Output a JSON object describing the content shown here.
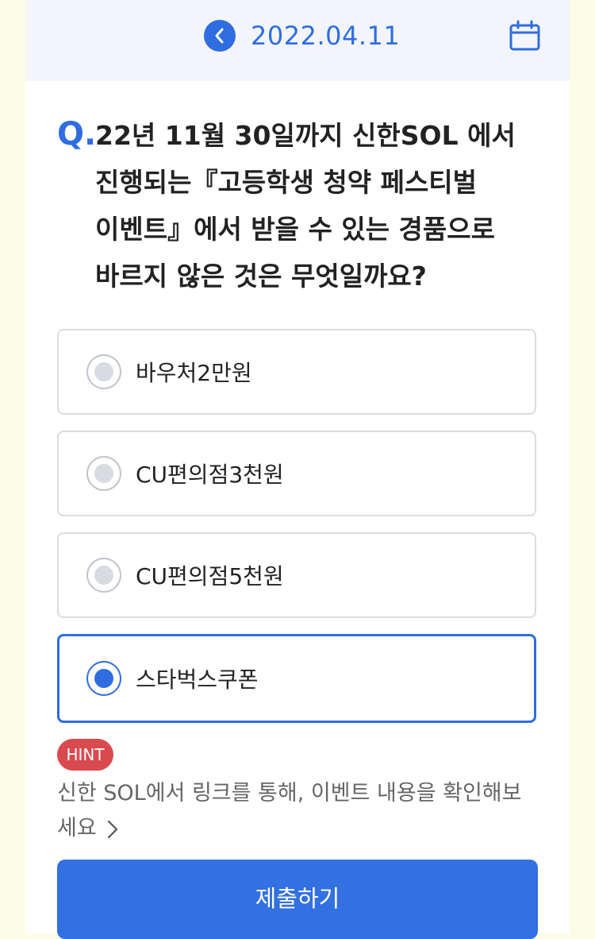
{
  "header": {
    "date": "2022.04.11",
    "back_icon": "chevron-left-icon",
    "calendar_icon": "calendar-icon"
  },
  "question": {
    "marker": "Q.",
    "text": "22년 11월 30일까지 신한SOL 에서 진행되는『고등학생 청약 페스티벌 이벤트』에서 받을 수 있는 경품으로 바르지 않은 것은 무엇일까요?"
  },
  "options": [
    {
      "label": "바우처2만원",
      "selected": false
    },
    {
      "label": "CU편의점3천원",
      "selected": false
    },
    {
      "label": "CU편의점5천원",
      "selected": false
    },
    {
      "label": "스타벅스쿠폰",
      "selected": true
    }
  ],
  "hint": {
    "badge": "HINT",
    "text": "신한 SOL에서 링크를 통해, 이벤트 내용을 확인해보세요"
  },
  "submit": {
    "label": "제출하기"
  },
  "colors": {
    "accent": "#2f6de0",
    "hint_badge": "#d94a4f",
    "page_bg": "#fdfce6"
  }
}
